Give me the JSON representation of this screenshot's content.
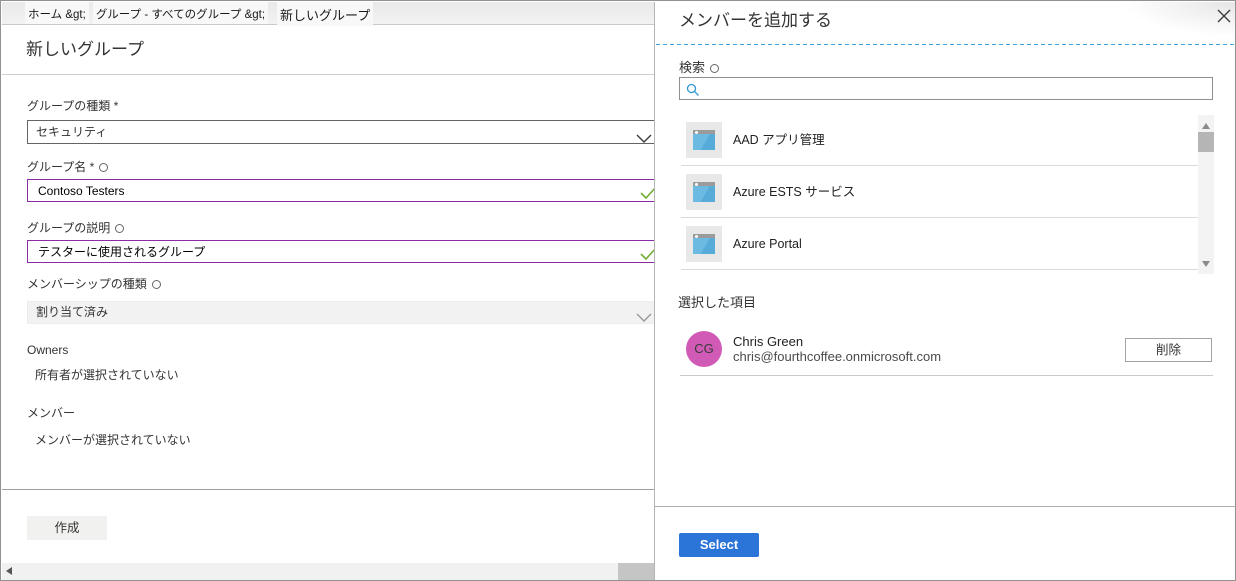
{
  "breadcrumb": {
    "items": [
      {
        "label": "ホーム &gt;"
      },
      {
        "label": "グループ - すべてのグループ  &gt;"
      },
      {
        "label": "新しいグループ"
      }
    ]
  },
  "page": {
    "title": "新しいグループ"
  },
  "form": {
    "group_type": {
      "label": "グループの種類 *",
      "value": "セキュリティ"
    },
    "group_name": {
      "label": "グループ名 *",
      "value": "Contoso Testers"
    },
    "group_description": {
      "label": "グループの説明",
      "value": "テスターに使用されるグループ"
    },
    "membership_type": {
      "label": "メンバーシップの種類",
      "value": "割り当て済み"
    },
    "owners": {
      "label": "Owners",
      "empty_text": "所有者が選択されていない"
    },
    "members": {
      "label": "メンバー",
      "empty_text": "メンバーが選択されていない"
    },
    "create_label": "作成"
  },
  "panel": {
    "title": "メンバーを追加する",
    "search": {
      "label": "検索",
      "value": ""
    },
    "directory": {
      "items": [
        {
          "name": "AAD アプリ管理"
        },
        {
          "name": "Azure ESTS サービス"
        },
        {
          "name": "Azure Portal"
        }
      ]
    },
    "selected": {
      "label": "選択した項目",
      "person": {
        "initials": "CG",
        "name": "Chris Green",
        "email": "chris@fourthcoffee.onmicrosoft.com"
      },
      "remove_label": "削除"
    },
    "select_label": "Select"
  },
  "colors": {
    "accent_blue": "#2b74d8",
    "dashed_divider_blue": "#39a3df",
    "valid_green": "#72ad33",
    "edited_purple": "#8a2da5",
    "avatar_pink": "#d05ab5"
  }
}
